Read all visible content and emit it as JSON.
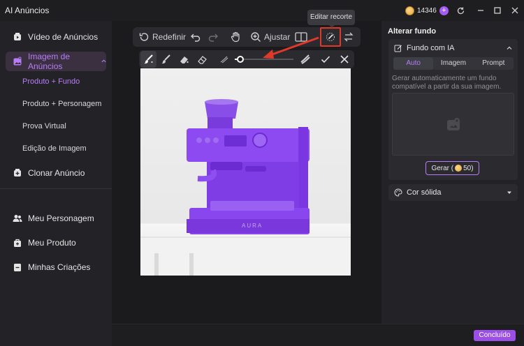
{
  "app": {
    "title": "AI Anúncios"
  },
  "titlebar": {
    "credits": "14346"
  },
  "sidebar": {
    "items": [
      {
        "label": "Vídeo de Anúncios"
      },
      {
        "label": "Imagem de Anúncios"
      },
      {
        "label": "Clonar Anúncio"
      },
      {
        "label": "Meu Personagem"
      },
      {
        "label": "Meu Produto"
      },
      {
        "label": "Minhas Criações"
      }
    ],
    "subitems": [
      {
        "label": "Produto + Fundo"
      },
      {
        "label": "Produto + Personagem"
      },
      {
        "label": "Prova Virtual"
      },
      {
        "label": "Edição de Imagem"
      }
    ]
  },
  "toolbar": {
    "reset_label": "Redefinir",
    "adjust_label": "Ajustar",
    "tooltip": "Editar recorte",
    "brush_size_fraction": 0.1
  },
  "image": {
    "brand_text": "AURA"
  },
  "right_panel": {
    "title": "Alterar fundo",
    "ai_bg": {
      "label": "Fundo com IA",
      "tabs": [
        "Auto",
        "Imagem",
        "Prompt"
      ],
      "active_tab": "Auto",
      "description": "Gerar automaticamente um fundo compatível a partir da sua imagem.",
      "generate_label": "Gerar (",
      "generate_cost": "50)"
    },
    "solid": {
      "label": "Cor sólida"
    }
  },
  "footer": {
    "done_label": "Concluído"
  },
  "colors": {
    "accent": "#b77df8",
    "highlight": "#e0392c",
    "product_overlay": "#8a3cf0"
  }
}
